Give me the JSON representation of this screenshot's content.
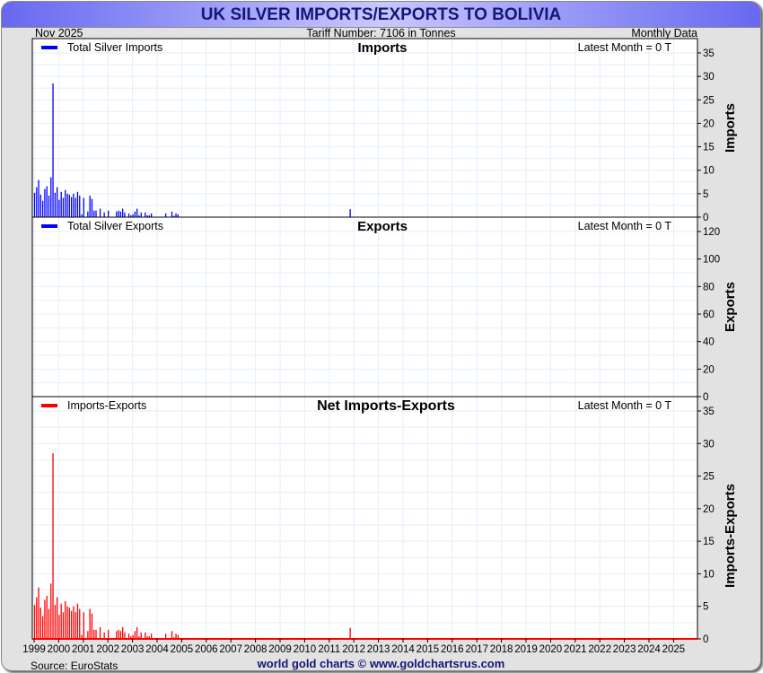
{
  "header": {
    "title": "UK SILVER IMPORTS/EXPORTS TO BOLIVIA",
    "date": "Nov  2025",
    "tariff": "Tariff Number: 7106 in Tonnes",
    "frequency": "Monthly Data"
  },
  "footer": {
    "source": "Source: EuroStats",
    "credit": "world gold charts © www.goldchartsrus.com"
  },
  "colors": {
    "imports": "#0000ff",
    "exports": "#0000ff",
    "net": "#ff0000"
  },
  "chart_data": [
    {
      "type": "bar",
      "title": "Imports",
      "legend": "Total Silver Imports",
      "latest": "Latest Month = 0 T",
      "ylabel": "Imports",
      "ylim": [
        0,
        35
      ],
      "yticks": [
        0,
        5,
        10,
        15,
        20,
        25,
        30,
        35
      ],
      "series": [
        {
          "name": "Total Silver Imports",
          "points": [
            [
              "1999-01",
              5.2
            ],
            [
              "1999-02",
              6.4
            ],
            [
              "1999-03",
              7.9
            ],
            [
              "1999-04",
              4.8
            ],
            [
              "1999-05",
              3.5
            ],
            [
              "1999-06",
              6.0
            ],
            [
              "1999-07",
              6.6
            ],
            [
              "1999-08",
              4.6
            ],
            [
              "1999-09",
              8.5
            ],
            [
              "1999-10",
              28.5
            ],
            [
              "1999-11",
              5.2
            ],
            [
              "1999-12",
              6.4
            ],
            [
              "2000-01",
              3.7
            ],
            [
              "2000-02",
              5.4
            ],
            [
              "2000-03",
              4.1
            ],
            [
              "2000-04",
              5.8
            ],
            [
              "2000-05",
              5.0
            ],
            [
              "2000-06",
              4.8
            ],
            [
              "2000-07",
              4.3
            ],
            [
              "2000-08",
              5.0
            ],
            [
              "2000-09",
              4.1
            ],
            [
              "2000-10",
              5.4
            ],
            [
              "2000-11",
              4.6
            ],
            [
              "2000-12",
              0.6
            ],
            [
              "2001-01",
              4.1
            ],
            [
              "2001-03",
              1.2
            ],
            [
              "2001-04",
              4.6
            ],
            [
              "2001-05",
              3.9
            ],
            [
              "2001-06",
              1.4
            ],
            [
              "2001-07",
              1.4
            ],
            [
              "2001-09",
              1.8
            ],
            [
              "2001-11",
              1.0
            ],
            [
              "2002-01",
              1.4
            ],
            [
              "2002-05",
              1.2
            ],
            [
              "2002-06",
              1.4
            ],
            [
              "2002-07",
              1.2
            ],
            [
              "2002-08",
              1.8
            ],
            [
              "2002-09",
              1.0
            ],
            [
              "2002-11",
              0.8
            ],
            [
              "2002-12",
              0.4
            ],
            [
              "2003-01",
              0.6
            ],
            [
              "2003-02",
              1.2
            ],
            [
              "2003-03",
              1.8
            ],
            [
              "2003-04",
              0.4
            ],
            [
              "2003-05",
              1.0
            ],
            [
              "2003-07",
              1.0
            ],
            [
              "2003-08",
              0.4
            ],
            [
              "2003-09",
              0.4
            ],
            [
              "2003-10",
              0.8
            ],
            [
              "2004-05",
              0.8
            ],
            [
              "2004-08",
              1.2
            ],
            [
              "2004-09",
              0.3
            ],
            [
              "2004-10",
              0.8
            ],
            [
              "2004-11",
              0.6
            ],
            [
              "2011-11",
              1.7
            ]
          ]
        }
      ]
    },
    {
      "type": "bar",
      "title": "Exports",
      "legend": "Total Silver Exports",
      "latest": "Latest Month = 0 T",
      "ylabel": "Exports",
      "ylim": [
        0,
        120
      ],
      "yticks": [
        0,
        20,
        40,
        60,
        80,
        100,
        120
      ],
      "series": [
        {
          "name": "Total Silver Exports",
          "points": []
        }
      ]
    },
    {
      "type": "bar",
      "title": "Net Imports-Exports",
      "legend": "Imports-Exports",
      "latest": "Latest Month = 0 T",
      "ylabel": "Imports-Exports",
      "ylim": [
        0,
        35
      ],
      "yticks": [
        0,
        5,
        10,
        15,
        20,
        25,
        30,
        35
      ],
      "series": [
        {
          "name": "Imports-Exports",
          "points": "same_as_imports"
        }
      ]
    }
  ],
  "xaxis": {
    "ticks": [
      "1999",
      "2000",
      "2001",
      "2002",
      "2003",
      "2004",
      "2005",
      "2006",
      "2007",
      "2008",
      "2009",
      "2010",
      "2011",
      "2012",
      "2013",
      "2014",
      "2015",
      "2016",
      "2017",
      "2018",
      "2019",
      "2020",
      "2021",
      "2022",
      "2023",
      "2024",
      "2025"
    ]
  }
}
